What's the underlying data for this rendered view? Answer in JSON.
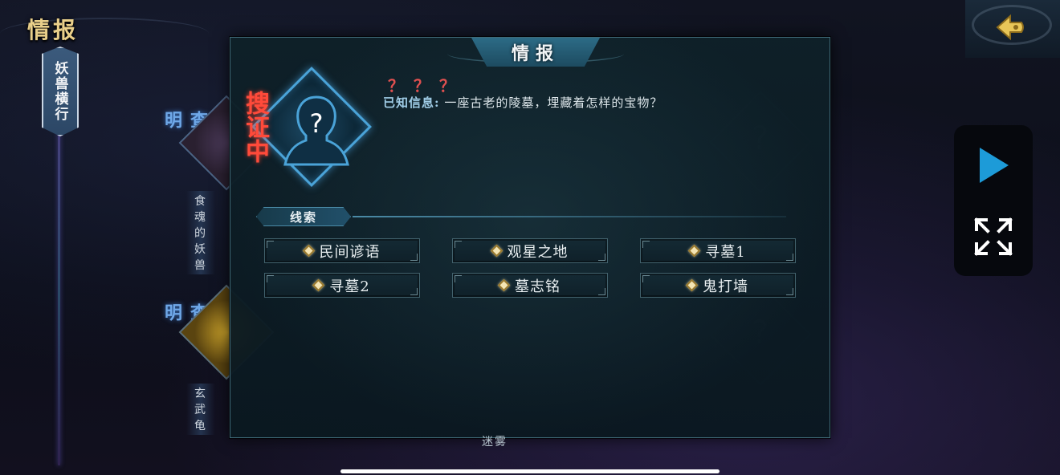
{
  "top": {
    "title": "情报",
    "side_tab_label": "妖兽横行"
  },
  "background_cards": [
    {
      "status": "已查明",
      "label": "食魂的妖兽"
    },
    {
      "status": "已查明",
      "label": "玄武龟"
    }
  ],
  "background_bottom_label": "迷雾",
  "panel": {
    "title": "情报",
    "status_tag": "搜证中",
    "mystery_marks": "？？？",
    "known_info_label": "已知信息:",
    "known_info_text": "一座古老的陵墓，埋藏着怎样的宝物？",
    "clue_section_label": "线索",
    "clues": [
      "民间谚语",
      "观星之地",
      "寻墓1",
      "寻墓2",
      "墓志铭",
      "鬼打墙"
    ]
  },
  "controls": {
    "back_icon": "back-arrow-icon",
    "play_icon": "play-icon",
    "fullscreen_icon": "fullscreen-expand-icon"
  },
  "colors": {
    "accent_gold": "#e9cf8a",
    "status_red": "#ff4a3a",
    "status_blue": "#6fa8e8",
    "panel_border": "#3f6a78",
    "play_blue": "#1d9bd8"
  }
}
